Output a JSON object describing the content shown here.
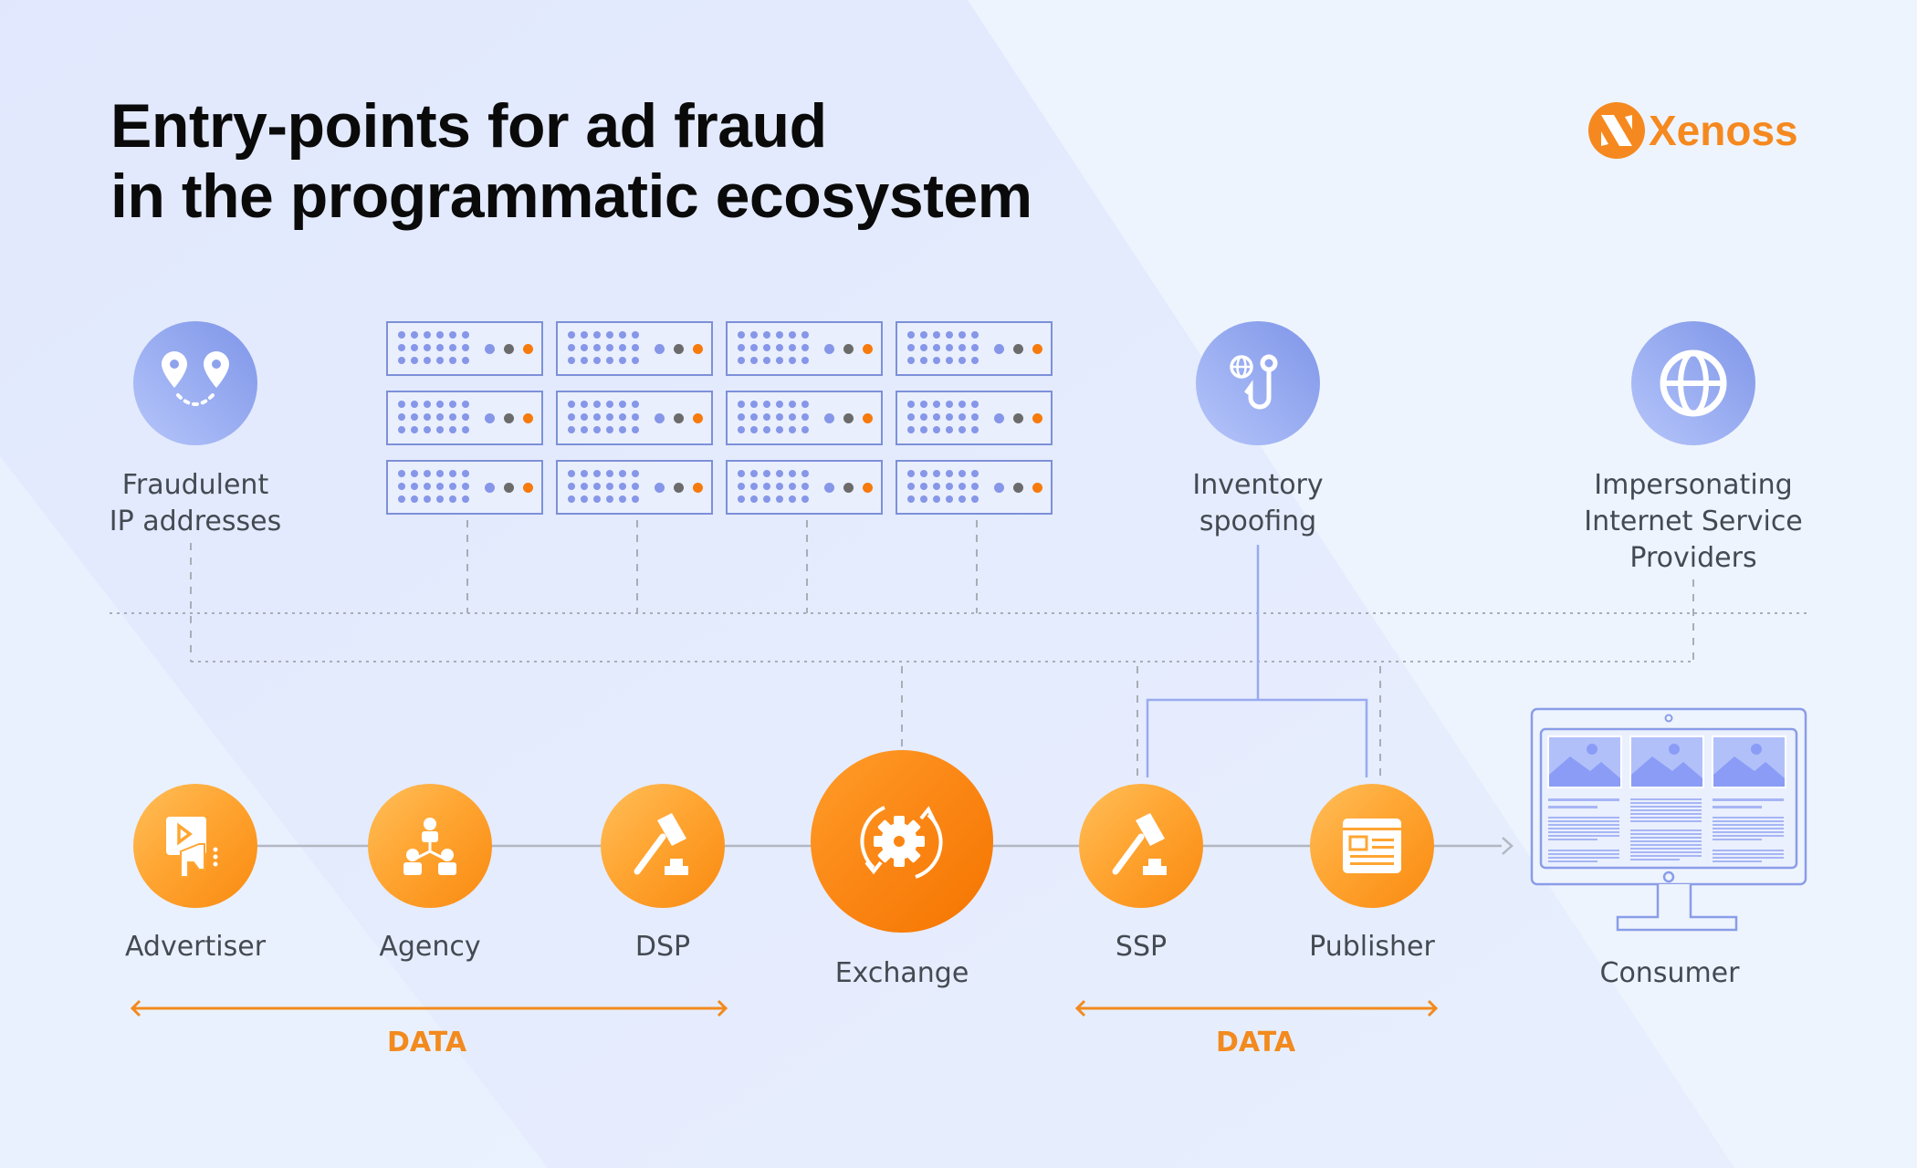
{
  "title": {
    "line1": "Entry-points for ad fraud",
    "line2": "in the programmatic ecosystem"
  },
  "brand": {
    "name": "Xenoss",
    "icon": "xenoss-logo-icon",
    "color": "#f5891f"
  },
  "threats": [
    {
      "id": "fraudulent-ip",
      "icon": "map-pins-route-icon",
      "lines": [
        "Fraudulent",
        "IP addresses"
      ]
    },
    {
      "id": "inventory-spoofing",
      "icon": "globe-hook-icon",
      "lines": [
        "Inventory",
        "spoofing"
      ]
    },
    {
      "id": "impersonating-isp",
      "icon": "globe-icon",
      "lines": [
        "Impersonating",
        "Internet Service",
        "Providers"
      ]
    }
  ],
  "servers": {
    "rows": 3,
    "columns": 4,
    "icon": "server-rack-icon",
    "led_colors": [
      "#8696e8",
      "#6b6b6b",
      "#f77a0c"
    ]
  },
  "chain": [
    {
      "id": "advertiser",
      "label": "Advertiser",
      "icon": "video-megaphone-icon"
    },
    {
      "id": "agency",
      "label": "Agency",
      "icon": "org-chart-people-icon"
    },
    {
      "id": "dsp",
      "label": "DSP",
      "icon": "gavel-icon"
    },
    {
      "id": "exchange",
      "label": "Exchange",
      "icon": "gear-cycle-icon"
    },
    {
      "id": "ssp",
      "label": "SSP",
      "icon": "gavel-icon"
    },
    {
      "id": "publisher",
      "label": "Publisher",
      "icon": "newspaper-page-icon"
    },
    {
      "id": "consumer",
      "label": "Consumer",
      "icon": "desktop-monitor-icon"
    }
  ],
  "data_spans": [
    {
      "label": "DATA",
      "from": "Advertiser",
      "to": "DSP"
    },
    {
      "label": "DATA",
      "from": "SSP",
      "to": "Publisher"
    }
  ],
  "colors": {
    "orange": "#f98a10",
    "blue": "#7f95e8",
    "text": "#444a52",
    "data": "#f28a1e"
  }
}
